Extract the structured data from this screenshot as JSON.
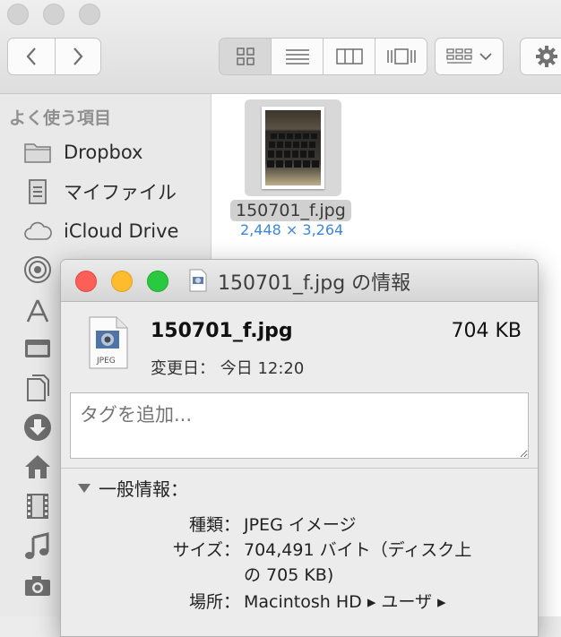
{
  "sidebar": {
    "heading": "よく使う項目",
    "items": [
      {
        "label": "Dropbox",
        "icon": "folder-icon"
      },
      {
        "label": "マイファイル",
        "icon": "all-my-files-icon"
      },
      {
        "label": "iCloud Drive",
        "icon": "cloud-icon"
      },
      {
        "label": "",
        "icon": "airdrop-icon"
      },
      {
        "label": "",
        "icon": "applications-icon"
      },
      {
        "label": "",
        "icon": "desktop-icon"
      },
      {
        "label": "",
        "icon": "documents-icon"
      },
      {
        "label": "",
        "icon": "downloads-icon"
      },
      {
        "label": "",
        "icon": "home-icon"
      },
      {
        "label": "",
        "icon": "movies-icon"
      },
      {
        "label": "",
        "icon": "music-icon"
      },
      {
        "label": "",
        "icon": "pictures-icon"
      }
    ]
  },
  "content": {
    "file": {
      "name": "150701_f.jpg",
      "dimensions": "2,448 × 3,264"
    }
  },
  "info_window": {
    "title": "150701_f.jpg の情報",
    "file_name": "150701_f.jpg",
    "file_size": "704 KB",
    "icon_label": "JPEG",
    "modified": "変更日：  今日 12:20",
    "tag_placeholder": "タグを追加...",
    "section_title": "一般情報：",
    "rows": [
      {
        "label": "種類：",
        "value": "JPEG イメージ"
      },
      {
        "label": "サイズ：",
        "value": "704,491 バイト（ディスク上"
      },
      {
        "label": "",
        "value": "の 705 KB)"
      },
      {
        "label": "場所：",
        "value": "Macintosh HD ▸ ユーザ ▸"
      }
    ]
  },
  "colors": {
    "close": "#fc5f57",
    "minimize": "#fdbc2e",
    "zoom": "#2ac940",
    "accent": "#3f86d6"
  }
}
